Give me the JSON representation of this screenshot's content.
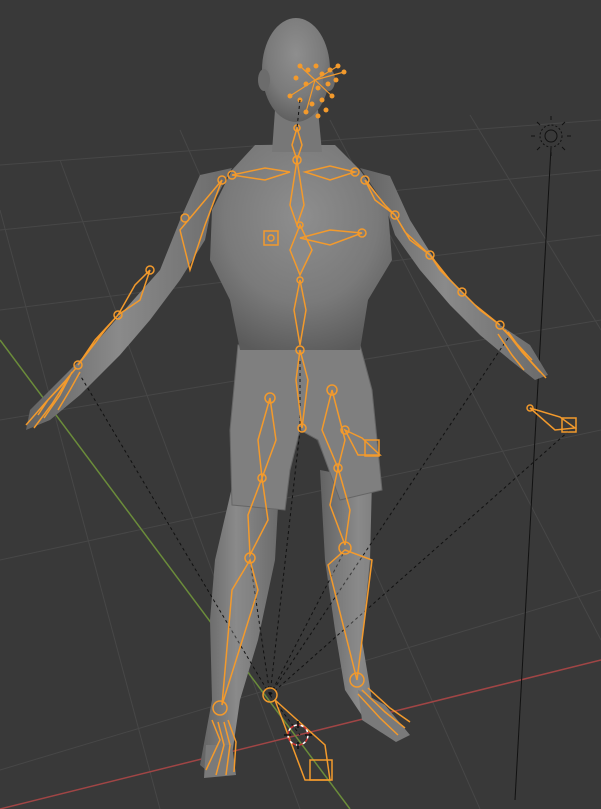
{
  "viewport": {
    "background": "#393939",
    "grid_color": "#474747",
    "x_axis_color": "#a04545",
    "y_axis_color": "#6b8c3a",
    "mesh_color": "#7d7d7d",
    "mesh_shadow": "#5e5e5e",
    "bone_color": "#f39a2c",
    "selected_bone_fill": "#8a8a8a",
    "relationship_line_color": "#111111"
  },
  "objects": {
    "mesh": {
      "icon": "human-mesh"
    },
    "armature": {
      "icon": "armature-bones",
      "selected": true
    },
    "light": {
      "icon": "sun-lamp-icon"
    },
    "camera": {
      "icon": "camera-target-icon"
    },
    "ik_targets": [
      "left-foot-ik",
      "right-foot-ik",
      "left-hand-ik",
      "right-hand-ik"
    ]
  }
}
